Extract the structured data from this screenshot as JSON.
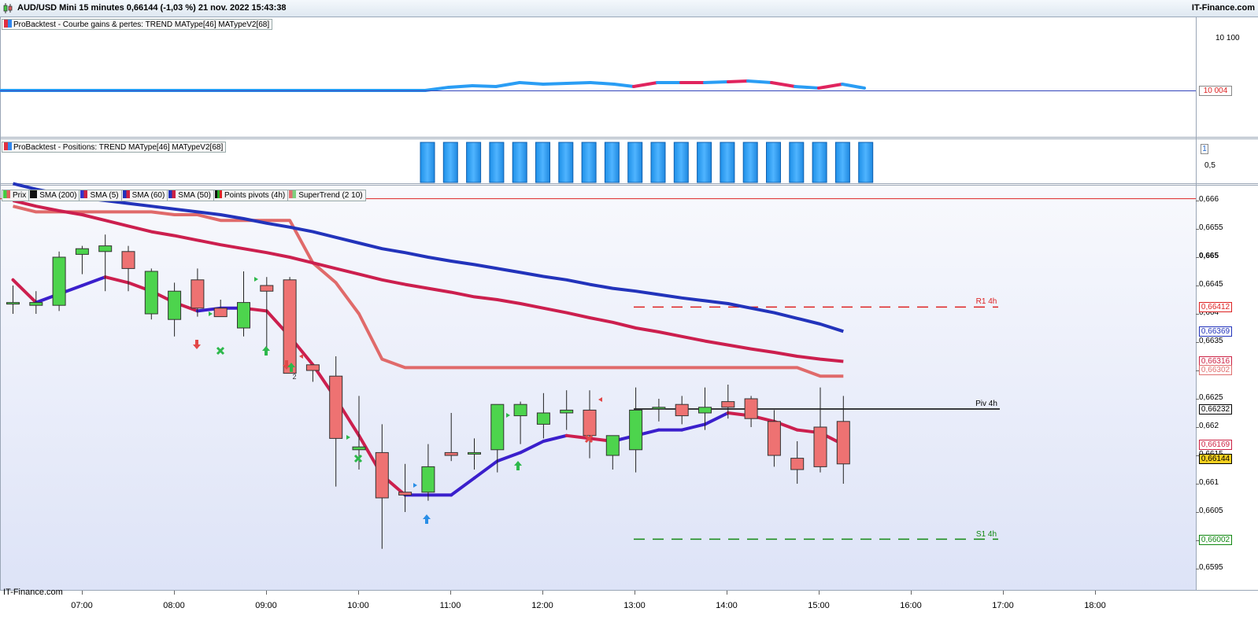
{
  "header": {
    "title": "AUD/USD Mini 15 minutes 0,66144 (-1,03 %) 21 nov. 2022 15:43:38",
    "brand": "IT-Finance.com"
  },
  "panels": {
    "equity": {
      "legend": "ProBacktest - Courbe gains & pertes: TREND MAType[46] MATypeV2[68]",
      "axis_labels": [
        "10 100"
      ],
      "last_value": "10 004"
    },
    "positions": {
      "legend": "ProBacktest - Positions: TREND MAType[46] MATypeV2[68]",
      "axis_labels": [
        "0,5"
      ],
      "last_value": "1"
    },
    "price": {
      "legend": [
        {
          "label": "Prix",
          "color": "#44cc44"
        },
        {
          "label": "SMA (200)",
          "color": "#111111"
        },
        {
          "label": "SMA (5)",
          "color": "#3333cc"
        },
        {
          "label": "SMA (60)",
          "color": "#cc2244"
        },
        {
          "label": "SMA (50)",
          "color": "#2233bb"
        },
        {
          "label": "Points pivots (4h)",
          "color": "#22aa22"
        },
        {
          "label": "SuperTrend (2 10)",
          "color": "#e07070"
        }
      ],
      "axis_labels": [
        "0,666",
        "0,6655",
        "0,665",
        "0,6645",
        "0,664",
        "0,6635",
        "0,663",
        "0,6625",
        "0,662",
        "0,6615",
        "0,661",
        "0,6605",
        "0,66",
        "0,6595"
      ],
      "value_tags": [
        {
          "text": "0,66412",
          "color": "#dd2222"
        },
        {
          "text": "0,66369",
          "color": "#2233bb"
        },
        {
          "text": "0,66316",
          "color": "#cc2244"
        },
        {
          "text": "0,66302",
          "color": "#e07070"
        },
        {
          "text": "0,66232",
          "color": "#000000"
        },
        {
          "text": "0,66169",
          "color": "#cc2244"
        },
        {
          "text": "0,66144",
          "color": "#000000",
          "bg": "#f5d020"
        },
        {
          "text": "0,66002",
          "color": "#118811"
        }
      ],
      "pivot_labels": {
        "r1": "R1 4h",
        "piv": "Piv 4h",
        "s1": "S1 4h"
      },
      "signal_label": "2"
    }
  },
  "x_axis": [
    "07:00",
    "08:00",
    "09:00",
    "10:00",
    "11:00",
    "12:00",
    "13:00",
    "14:00",
    "15:00",
    "16:00",
    "17:00",
    "18:00"
  ],
  "watermark": "IT-Finance.com",
  "chart_data": {
    "type": "candlestick",
    "x": [
      "06:45",
      "07:00",
      "07:15",
      "07:30",
      "07:45",
      "08:00",
      "08:15",
      "08:30",
      "08:45",
      "09:00",
      "09:15",
      "09:30",
      "09:45",
      "10:00",
      "10:15",
      "10:30",
      "10:45",
      "11:00",
      "11:15",
      "11:30",
      "11:45",
      "12:00",
      "12:15",
      "12:30",
      "12:45",
      "13:00",
      "13:15",
      "13:30",
      "13:45",
      "14:00",
      "14:15",
      "14:30",
      "14:45",
      "15:00",
      "15:15",
      "15:30"
    ],
    "candles": [
      [
        0.6642,
        0.6645,
        0.664,
        0.6642
      ],
      [
        0.66415,
        0.6644,
        0.664,
        0.6642
      ],
      [
        0.66415,
        0.6651,
        0.66405,
        0.665
      ],
      [
        0.66505,
        0.6652,
        0.6647,
        0.66515
      ],
      [
        0.6651,
        0.6654,
        0.6644,
        0.6652
      ],
      [
        0.6651,
        0.6652,
        0.6644,
        0.6648
      ],
      [
        0.664,
        0.6648,
        0.6639,
        0.66475
      ],
      [
        0.6639,
        0.66455,
        0.6636,
        0.6644
      ],
      [
        0.6646,
        0.6648,
        0.66395,
        0.6641
      ],
      [
        0.6641,
        0.66425,
        0.664,
        0.66395
      ],
      [
        0.66375,
        0.66475,
        0.6636,
        0.6642
      ],
      [
        0.6645,
        0.66465,
        0.6634,
        0.6644
      ],
      [
        0.6646,
        0.66465,
        0.6633,
        0.66295
      ],
      [
        0.6631,
        0.663,
        0.6628,
        0.663
      ],
      [
        0.6629,
        0.66325,
        0.66095,
        0.6618
      ],
      [
        0.6616,
        0.66255,
        0.66125,
        0.66165
      ],
      [
        0.66155,
        0.66205,
        0.65985,
        0.66075
      ],
      [
        0.66085,
        0.66135,
        0.6605,
        0.6608
      ],
      [
        0.66085,
        0.6617,
        0.6607,
        0.6613
      ],
      [
        0.66155,
        0.66225,
        0.6614,
        0.6615
      ],
      [
        0.66155,
        0.6618,
        0.66125,
        0.66155
      ],
      [
        0.6616,
        0.6624,
        0.6612,
        0.6624
      ],
      [
        0.6622,
        0.66245,
        0.6617,
        0.6624
      ],
      [
        0.66205,
        0.6626,
        0.6618,
        0.66225
      ],
      [
        0.66225,
        0.66265,
        0.66195,
        0.6623
      ],
      [
        0.6623,
        0.66265,
        0.66145,
        0.66185
      ],
      [
        0.6615,
        0.6617,
        0.66125,
        0.66185
      ],
      [
        0.6616,
        0.6627,
        0.6612,
        0.6623
      ],
      [
        0.66235,
        0.6625,
        0.6621,
        0.66235
      ],
      [
        0.6624,
        0.66255,
        0.66205,
        0.6622
      ],
      [
        0.66225,
        0.6627,
        0.66195,
        0.66235
      ],
      [
        0.66245,
        0.66275,
        0.66215,
        0.66235
      ],
      [
        0.6625,
        0.66255,
        0.662,
        0.66215
      ],
      [
        0.6621,
        0.6623,
        0.6613,
        0.6615
      ],
      [
        0.66145,
        0.66175,
        0.661,
        0.66125
      ],
      [
        0.662,
        0.6627,
        0.6612,
        0.6613
      ],
      [
        0.6621,
        0.66255,
        0.661,
        0.66135
      ]
    ],
    "sma5": [
      0.6646,
      0.6642,
      0.66435,
      0.6645,
      0.66465,
      0.66455,
      0.6644,
      0.6642,
      0.66405,
      0.6641,
      0.6641,
      0.66405,
      0.6636,
      0.6631,
      0.6625,
      0.66185,
      0.66115,
      0.6608,
      0.6608,
      0.6608,
      0.6611,
      0.6614,
      0.66155,
      0.66175,
      0.66185,
      0.6618,
      0.66175,
      0.66185,
      0.66195,
      0.66195,
      0.66205,
      0.66225,
      0.6622,
      0.6621,
      0.66195,
      0.6619,
      0.66169
    ],
    "sma60": [
      0.666,
      0.6659,
      0.66582,
      0.66575,
      0.66565,
      0.66555,
      0.66545,
      0.66538,
      0.6653,
      0.66522,
      0.66515,
      0.66508,
      0.665,
      0.6649,
      0.6648,
      0.6647,
      0.6646,
      0.66452,
      0.66445,
      0.66438,
      0.6643,
      0.66425,
      0.66418,
      0.6641,
      0.66402,
      0.66393,
      0.66385,
      0.66375,
      0.66368,
      0.6636,
      0.66352,
      0.66345,
      0.66338,
      0.66332,
      0.66325,
      0.6632,
      0.66316
    ],
    "sma50": [
      0.6663,
      0.6662,
      0.66612,
      0.66605,
      0.666,
      0.66595,
      0.6659,
      0.66585,
      0.6658,
      0.66575,
      0.66568,
      0.6656,
      0.66553,
      0.66545,
      0.66535,
      0.66525,
      0.66515,
      0.66508,
      0.665,
      0.66493,
      0.66487,
      0.6648,
      0.66473,
      0.66466,
      0.6646,
      0.66452,
      0.66445,
      0.6644,
      0.66434,
      0.66428,
      0.66423,
      0.66418,
      0.6641,
      0.66402,
      0.66392,
      0.66382,
      0.66369
    ],
    "supertrend": [
      0.6659,
      0.6658,
      0.6658,
      0.6658,
      0.6658,
      0.6658,
      0.6658,
      0.66575,
      0.66575,
      0.66565,
      0.66565,
      0.66565,
      0.66565,
      0.6649,
      0.66455,
      0.664,
      0.6632,
      0.66305,
      0.66305,
      0.66305,
      0.66305,
      0.66305,
      0.66305,
      0.66305,
      0.66305,
      0.66305,
      0.66305,
      0.66305,
      0.66305,
      0.66305,
      0.66305,
      0.66305,
      0.66305,
      0.66305,
      0.66305,
      0.6629,
      0.6629
    ],
    "levels": {
      "sma200": 0.66604,
      "r1_4h": 0.66412,
      "piv_4h": 0.66232,
      "s1_4h": 0.66002
    },
    "equity_last": 10004,
    "y_range": [
      0.6592,
      0.6661
    ]
  }
}
